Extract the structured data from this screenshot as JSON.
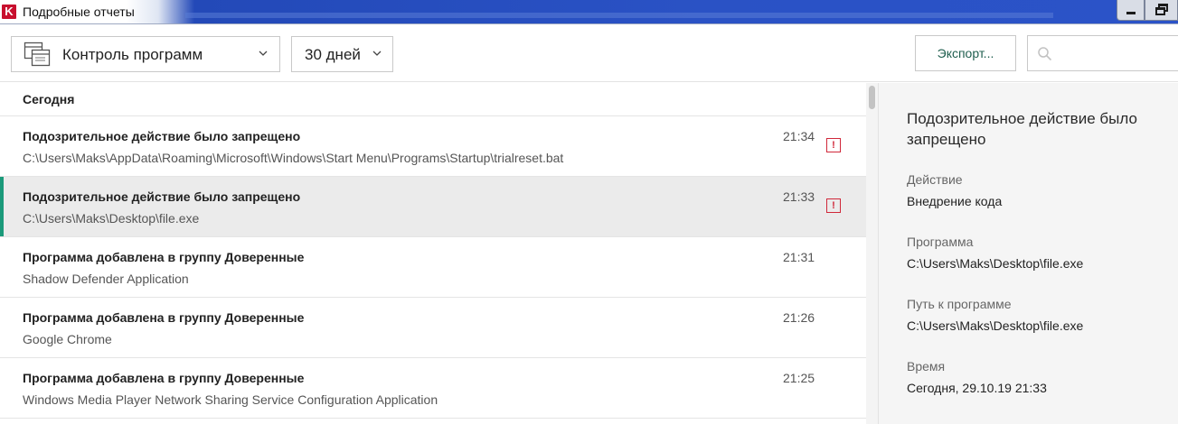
{
  "window": {
    "logo_letter": "K",
    "title": "Подробные отчеты"
  },
  "toolbar": {
    "component_select": "Контроль программ",
    "period_select": "30 дней",
    "export_label": "Экспорт...",
    "search_placeholder": ""
  },
  "list": {
    "section": "Сегодня",
    "items": [
      {
        "title": "Подозрительное действие было запрещено",
        "subtitle": "C:\\Users\\Maks\\AppData\\Roaming\\Microsoft\\Windows\\Start Menu\\Programs\\Startup\\trialreset.bat",
        "time": "21:34",
        "alert": "!"
      },
      {
        "title": "Подозрительное действие было запрещено",
        "subtitle": "C:\\Users\\Maks\\Desktop\\file.exe",
        "time": "21:33",
        "alert": "!"
      },
      {
        "title": "Программа добавлена в группу Доверенные",
        "subtitle": "Shadow Defender Application",
        "time": "21:31"
      },
      {
        "title": "Программа добавлена в группу Доверенные",
        "subtitle": "Google Chrome",
        "time": "21:26"
      },
      {
        "title": "Программа добавлена в группу Доверенные",
        "subtitle": "Windows Media Player Network Sharing Service Configuration Application",
        "time": "21:25"
      }
    ]
  },
  "details": {
    "title": "Подозрительное действие было запрещено",
    "fields": [
      {
        "label": "Действие",
        "value": "Внедрение кода"
      },
      {
        "label": "Программа",
        "value": "C:\\Users\\Maks\\Desktop\\file.exe"
      },
      {
        "label": "Путь к программе",
        "value": "C:\\Users\\Maks\\Desktop\\file.exe"
      },
      {
        "label": "Время",
        "value": "Сегодня, 29.10.19 21:33"
      }
    ]
  },
  "colors": {
    "selection_accent": "#1b9a7a",
    "alert_red": "#d0283a",
    "export_text": "#1e5e4e",
    "titlebar_blue": "#2a52c5"
  },
  "icons": {
    "component": "window-list-icon",
    "dropdown": "chevron-down-icon",
    "search": "search-icon",
    "alert": "alert-icon"
  }
}
